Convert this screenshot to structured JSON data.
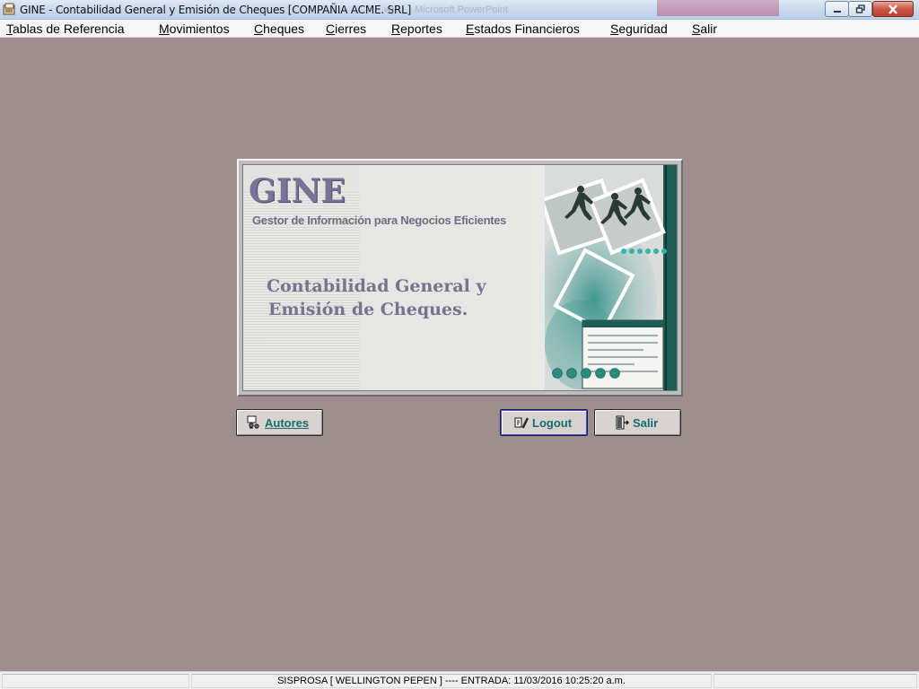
{
  "window": {
    "title": "GINE - Contabilidad General y Emisión de Cheques [COMPAÑIA ACME. SRL]",
    "background_apps": [
      "Microsoft PowerPoint"
    ]
  },
  "menu": {
    "items": [
      {
        "access_key": "T",
        "rest": "ablas de Referencia"
      },
      {
        "access_key": "M",
        "rest": "ovimientos"
      },
      {
        "access_key": "C",
        "rest": "heques"
      },
      {
        "access_key": "C",
        "rest": "ierres"
      },
      {
        "access_key": "R",
        "rest": "eportes"
      },
      {
        "access_key": "E",
        "rest": "stados Financieros"
      },
      {
        "access_key": "S",
        "rest": "eguridad"
      },
      {
        "access_key": "S",
        "rest": "alir"
      }
    ]
  },
  "banner": {
    "logo": "GINE",
    "subtitle": "Gestor de Información para Negocios Eficientes",
    "app_name_line1": "Contabilidad General  y",
    "app_name_line2": "Emisión de Cheques."
  },
  "buttons": {
    "autores": {
      "access_key": "A",
      "rest": "utores",
      "icon": "people-icon"
    },
    "logout": {
      "label": "Logout",
      "icon": "key-pen-icon",
      "focused": true
    },
    "salir": {
      "label": "Salir",
      "icon": "exit-door-icon"
    }
  },
  "status": {
    "text": "SISPROSA [ WELLINGTON PEPEN ] ---- ENTRADA: 11/03/2016 10:25:20 a.m."
  },
  "colors": {
    "desktop": "#9e8e8d",
    "logo": "#7a7396",
    "button_text": "#166c6c",
    "teal_accent": "#1f6e66"
  }
}
